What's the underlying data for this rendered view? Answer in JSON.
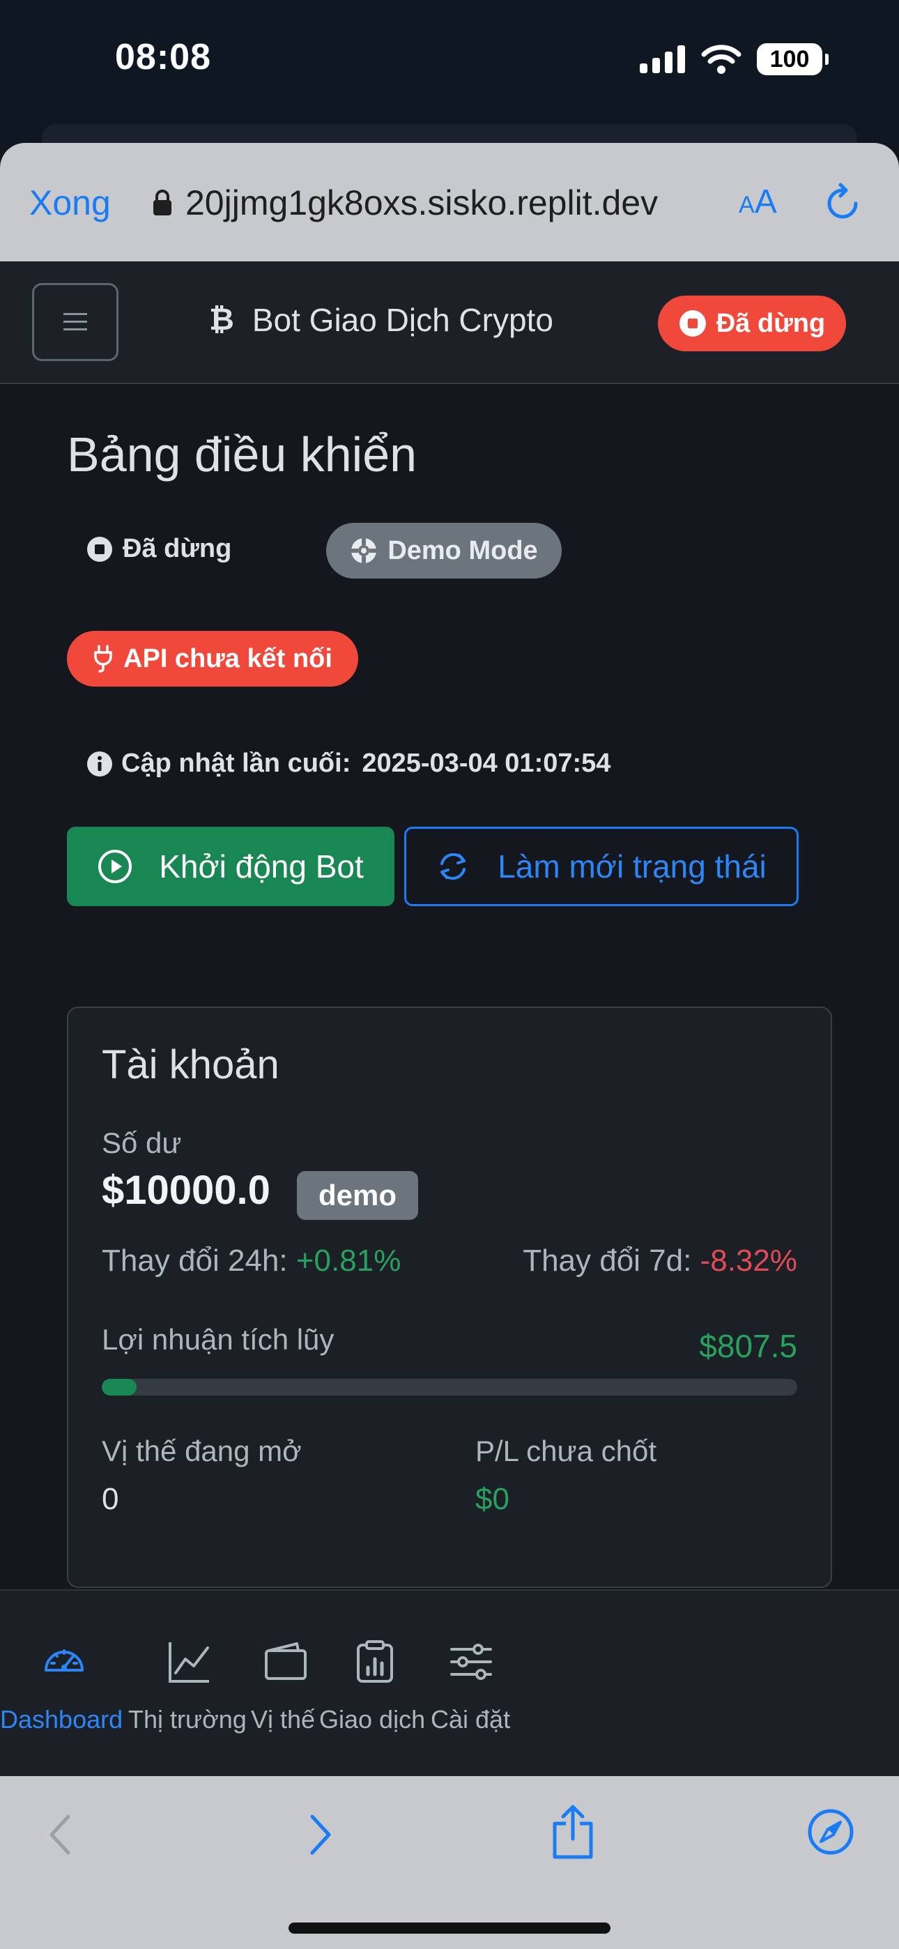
{
  "status_bar": {
    "time": "08:08",
    "battery": "100"
  },
  "browser": {
    "done_label": "Xong",
    "url": "20jjmg1gk8oxs.sisko.replit.dev",
    "text_size_label_small": "A",
    "text_size_label_large": "A"
  },
  "navbar": {
    "brand_icon": "₿",
    "brand_title": "Bot Giao Dịch Crypto",
    "status_badge": "Đã dừng"
  },
  "dashboard": {
    "title": "Bảng điều khiển",
    "bot_status": "Đã dừng",
    "mode_badge": "Demo Mode",
    "api_badge": "API chưa kết nối",
    "last_updated_label": "Cập nhật lần cuối:",
    "last_updated_value": "2025-03-04 01:07:54",
    "start_button": "Khởi động Bot",
    "refresh_button": "Làm mới trạng thái"
  },
  "account": {
    "title": "Tài khoản",
    "balance_label": "Số dư",
    "balance_value": "$10000.0",
    "balance_badge": "demo",
    "change_24h_label": "Thay đổi 24h:",
    "change_24h_value": "+0.81%",
    "change_7d_label": "Thay đổi 7d:",
    "change_7d_value": "-8.32%",
    "profit_label": "Lợi nhuận tích lũy",
    "profit_value": "$807.5",
    "profit_progress": 0.05,
    "open_positions_label": "Vị thế đang mở",
    "open_positions_value": "0",
    "unrealized_pl_label": "P/L chưa chốt",
    "unrealized_pl_value": "$0"
  },
  "tabs": [
    {
      "label": "Dashboard",
      "icon": "speedometer-icon",
      "active": true
    },
    {
      "label": "Thị trường",
      "icon": "graph-up-icon",
      "active": false
    },
    {
      "label": "Vị thế",
      "icon": "wallet-icon",
      "active": false
    },
    {
      "label": "Giao dịch",
      "icon": "clipboard-data-icon",
      "active": false
    },
    {
      "label": "Cài đặt",
      "icon": "sliders-icon",
      "active": false
    }
  ],
  "colors": {
    "success": "#198754",
    "danger": "#f0493c",
    "primary": "#1a7cf5",
    "secondary": "#6c757d"
  }
}
